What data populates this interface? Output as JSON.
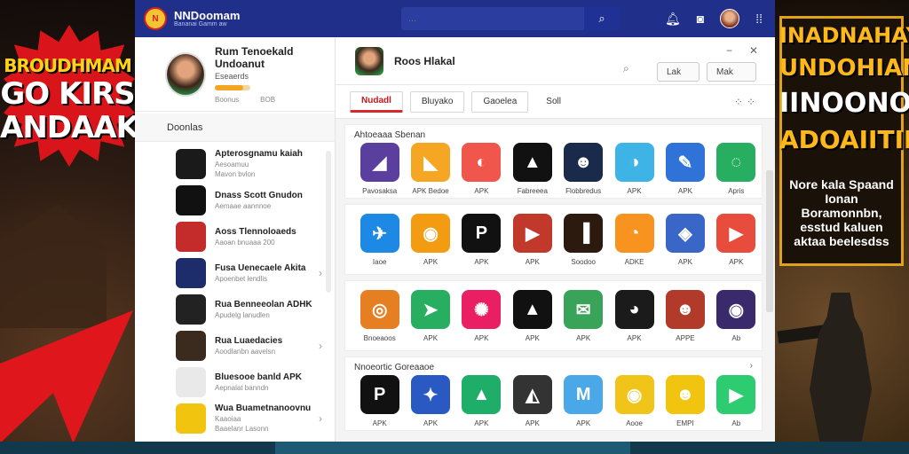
{
  "banner_left": {
    "line1": "BROUDHMAM",
    "line2": "GO KIRS",
    "line3": "ANDAAK"
  },
  "banner_right": {
    "line1": "INADNAHAY",
    "line2": "UNDOHIAN",
    "line3": "IINOONOIN",
    "line4": "ADOAIITIN!",
    "sub": "Nore kala Spaand Ionan Boramonnbn, esstud kaluen aktaa beelesdss"
  },
  "topbar": {
    "logo_text": "N",
    "title": "NNDoomam",
    "subtitle": "Bananai Gamm aw",
    "search_placeholder": "...",
    "icons": [
      "search-icon",
      "bell-icon",
      "chat-icon",
      "avatar",
      "grid-icon"
    ]
  },
  "profile": {
    "name": "Rum Tenoekald Undoanut",
    "sub": "Eseaerds",
    "progress": 0.8,
    "meta_left": "Boonus",
    "meta_right": "BOB"
  },
  "sidebar": {
    "heading": "Doonlas",
    "items": [
      {
        "title": "Apterosgnamu kaiah",
        "sub": "Aesoamuu",
        "meta": "Mavon bvlon",
        "color": "#1a1a1a"
      },
      {
        "title": "Dnass Scott Gnudon",
        "sub": "Aemaae aannnoe",
        "color": "#111"
      },
      {
        "title": "Aoss Tlennoloaeds",
        "sub": "Aaoan bnuaaa 200",
        "color": "#c42b2b"
      },
      {
        "title": "Fusa Uenecaele Akita",
        "sub": "Apoenbet lendlis",
        "color": "#1d2c6b"
      },
      {
        "title": "Rua Benneeolan ADHK",
        "sub": "Apudelg lanudlen",
        "color": "#222"
      },
      {
        "title": "Rua Luaedacies",
        "sub": "Aoodlanbn aavelsn",
        "color": "#3b2b1e"
      },
      {
        "title": "Bluesooe banld APK",
        "sub": "Aepnalat banndn",
        "color": "#e9e9e9"
      },
      {
        "title": "Wua Buametnanoovnu",
        "sub": "Kaaoiaa",
        "meta": "Baaelanr Lasonn",
        "color": "#f1c40f"
      }
    ]
  },
  "header": {
    "title": "Roos Hlakal",
    "btn1": "Lak",
    "btn2": "Mak",
    "tabs": [
      "Nudadl",
      "Bluyako",
      "Gaoelea",
      "Soll"
    ]
  },
  "sections": [
    {
      "label": "Ahtoeaaa Sbenan",
      "tiles": [
        {
          "label": "Pavosaksa",
          "color": "#5b3f9e",
          "glyph": "◢"
        },
        {
          "label": "APK Bedoe",
          "color": "#f5a623",
          "glyph": "◣"
        },
        {
          "label": "APK",
          "color": "#f0564b",
          "glyph": "◐"
        },
        {
          "label": "Fabreeea",
          "color": "#111",
          "glyph": "▲"
        },
        {
          "label": "Flobbredus",
          "color": "#1a2a4a",
          "glyph": "☻"
        },
        {
          "label": "APK",
          "color": "#3db3e6",
          "glyph": "◑"
        },
        {
          "label": "APK",
          "color": "#2f72d8",
          "glyph": "✎"
        },
        {
          "label": "Apris",
          "color": "#27ae60",
          "glyph": "◌"
        }
      ]
    },
    {
      "label": "",
      "tiles": [
        {
          "label": "Iaoe",
          "color": "#1e88e5",
          "glyph": "✈"
        },
        {
          "label": "APK",
          "color": "#f39c12",
          "glyph": "◉"
        },
        {
          "label": "APK",
          "color": "#111",
          "glyph": "P"
        },
        {
          "label": "APK",
          "color": "#c0392b",
          "glyph": "▶"
        },
        {
          "label": "Soodoo",
          "color": "#2d1a0e",
          "glyph": "▐"
        },
        {
          "label": "ADKE",
          "color": "#f7931e",
          "glyph": "◔"
        },
        {
          "label": "APK",
          "color": "#3a66c7",
          "glyph": "◈"
        },
        {
          "label": "APK",
          "color": "#e74c3c",
          "glyph": "▶"
        }
      ]
    },
    {
      "label": "",
      "tiles": [
        {
          "label": "Bnoeaoos",
          "color": "#e67e22",
          "glyph": "◎"
        },
        {
          "label": "APK",
          "color": "#27ae60",
          "glyph": "➤"
        },
        {
          "label": "APK",
          "color": "#e91e63",
          "glyph": "✺"
        },
        {
          "label": "APK",
          "color": "#111",
          "glyph": "▲"
        },
        {
          "label": "APK",
          "color": "#3aa35a",
          "glyph": "✉"
        },
        {
          "label": "APK",
          "color": "#1b1b1b",
          "glyph": "◕"
        },
        {
          "label": "APPE",
          "color": "#b23a2a",
          "glyph": "☻"
        },
        {
          "label": "Ab",
          "color": "#3a2a6b",
          "glyph": "◉"
        }
      ]
    },
    {
      "label": "Nnoeortic Goreaaoe",
      "tiles": [
        {
          "label": "APK",
          "color": "#111",
          "glyph": "P"
        },
        {
          "label": "APK",
          "color": "#2b59c3",
          "glyph": "✦"
        },
        {
          "label": "APK",
          "color": "#1fae6a",
          "glyph": "▲"
        },
        {
          "label": "APK",
          "color": "#333",
          "glyph": "◭"
        },
        {
          "label": "APK",
          "color": "#4aa8e8",
          "glyph": "M"
        },
        {
          "label": "Aooe",
          "color": "#f0c419",
          "glyph": "◉"
        },
        {
          "label": "EMPI",
          "color": "#f1c40f",
          "glyph": "☻"
        },
        {
          "label": "Ab",
          "color": "#2ecc71",
          "glyph": "▶"
        }
      ]
    }
  ]
}
